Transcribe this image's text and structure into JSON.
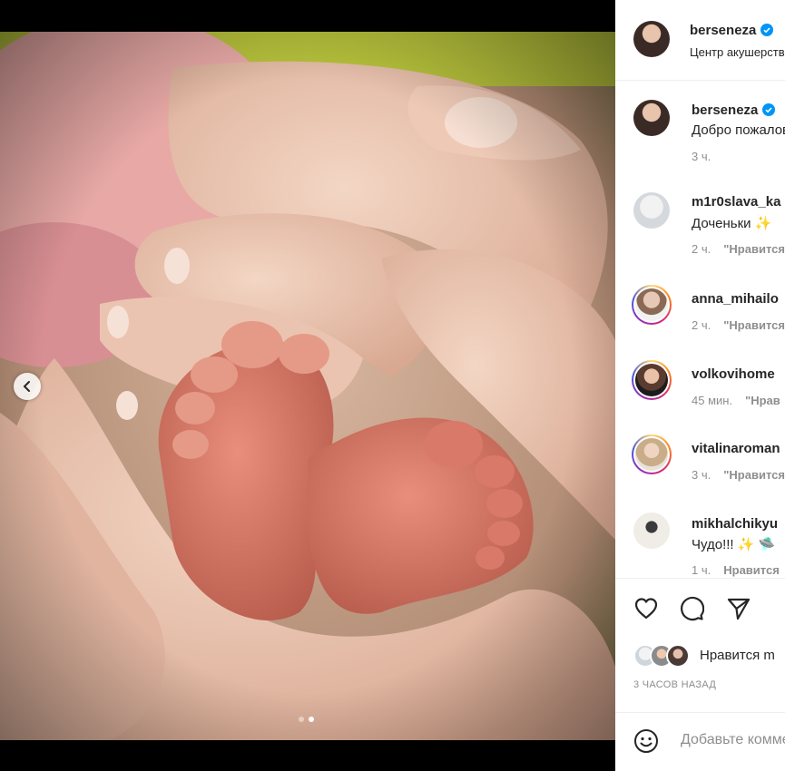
{
  "post": {
    "author": "berseneza",
    "location": "Центр акушерства",
    "caption": "Добро пожаловать",
    "caption_time": "3 ч.",
    "carousel_total": 2,
    "carousel_active": 2
  },
  "comments": [
    {
      "user": "m1r0slava_ka",
      "text": "Доченьки ✨",
      "time": "2 ч.",
      "reply": "\"Нравится\""
    },
    {
      "user": "anna_mihailo",
      "text": "",
      "time": "2 ч.",
      "reply": "\"Нравится\""
    },
    {
      "user": "volkovihome",
      "text": "",
      "time": "45 мин.",
      "reply": "\"Нрав"
    },
    {
      "user": "vitalinaroman",
      "text": "",
      "time": "3 ч.",
      "reply": "\"Нравится"
    },
    {
      "user": "mikhalchikyu",
      "text": "Чудо!!! ✨ 🛸",
      "time": "1 ч.",
      "reply": "Нравится"
    }
  ],
  "likes_text": "Нравится m",
  "posted_ago": "3 ЧАСОВ НАЗАД",
  "comment_placeholder": "Добавьте комментарий...",
  "icons": {
    "like": "heart-icon",
    "comment": "comment-bubble-icon",
    "share": "paper-plane-icon",
    "emoji": "smiley-icon",
    "prev": "chevron-left-icon",
    "verified": "verified-badge-icon"
  },
  "colors": {
    "verified": "#0095f6",
    "muted": "#8e8e8e"
  }
}
